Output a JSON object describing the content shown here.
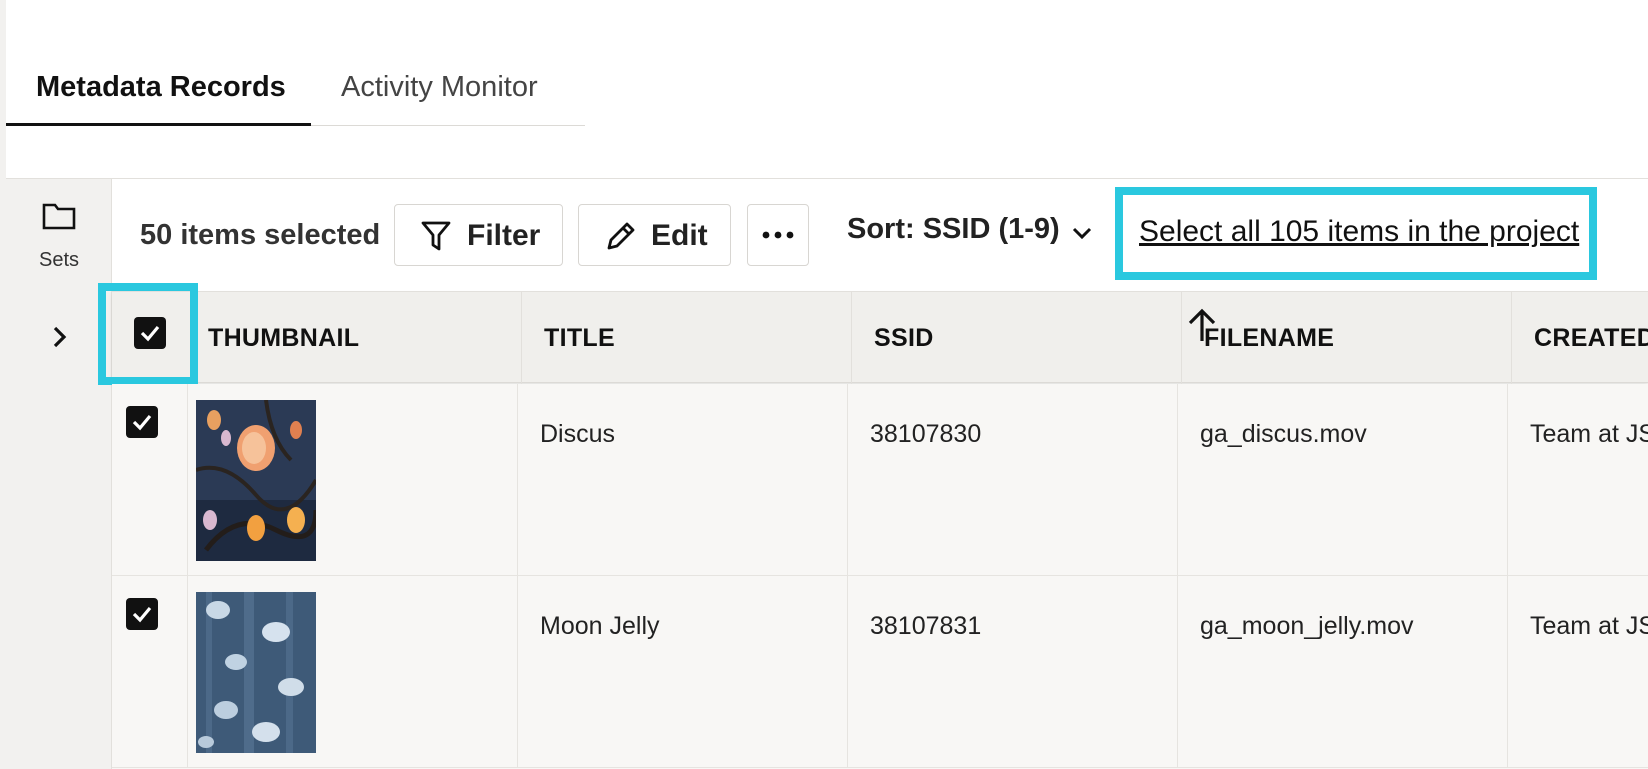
{
  "tabs": [
    {
      "label": "Metadata Records",
      "active": true
    },
    {
      "label": "Activity Monitor",
      "active": false
    }
  ],
  "rail": {
    "sets_label": "Sets",
    "folder_icon": "folder-icon",
    "expand_icon": "chevron-right-icon"
  },
  "toolbar": {
    "selection_count": "50 items selected",
    "filter_label": "Filter",
    "edit_label": "Edit",
    "more_icon": "more-horizontal-icon",
    "sort_label": "Sort: SSID (1-9)",
    "select_all_link": "Select all 105 items in the project"
  },
  "table": {
    "columns": [
      "THUMBNAIL",
      "TITLE",
      "SSID",
      "FILENAME",
      "CREATED"
    ],
    "sorted_column": "SSID",
    "sort_direction": "ascending",
    "rows": [
      {
        "checked": true,
        "title": "Discus",
        "ssid": "38107830",
        "filename": "ga_discus.mov",
        "created": "Team at JST"
      },
      {
        "checked": true,
        "title": "Moon Jelly",
        "ssid": "38107831",
        "filename": "ga_moon_jelly.mov",
        "created": "Team at JST"
      }
    ]
  },
  "colors": {
    "highlight": "#2ac8df",
    "rail_bg": "#f2f1ef",
    "header_bg": "#f0efec"
  }
}
